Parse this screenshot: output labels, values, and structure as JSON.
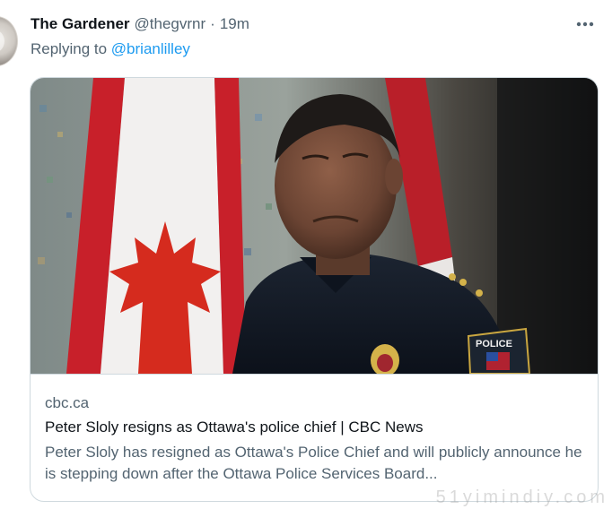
{
  "tweet": {
    "author_name": "The Gardener",
    "author_handle": "@thegvrnr",
    "separator": "·",
    "time": "19m",
    "reply_prefix": "Replying to",
    "reply_to": "@brianlilley"
  },
  "card": {
    "domain": "cbc.ca",
    "title": "Peter Sloly resigns as Ottawa's police chief | CBC News",
    "description": "Peter Sloly has resigned as Ottawa's Police Chief and will publicly announce he is stepping down after the Ottawa Police Services Board..."
  },
  "badges": {
    "shoulder_patch_text": "POLICE"
  },
  "watermark": "51yimindiy.com",
  "colors": {
    "link": "#1d9bf0",
    "secondary_text": "#536471",
    "primary_text": "#0f1419",
    "border": "#cfd9de",
    "flag_red": "#d52b1e"
  },
  "icons": {
    "more": "more-horizontal-icon",
    "avatar": "user-avatar"
  }
}
